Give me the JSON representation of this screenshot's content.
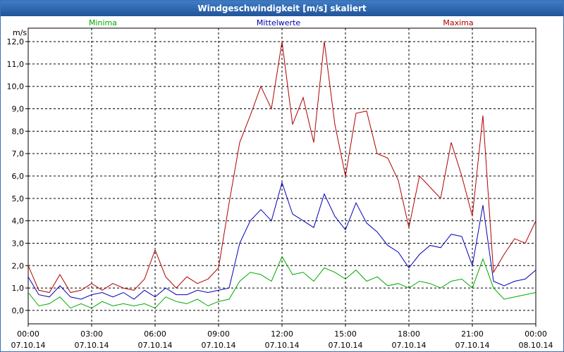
{
  "window": {
    "title": "Windgeschwindigkeit [m/s] skaliert"
  },
  "chart_data": {
    "type": "line",
    "title": "Windgeschwindigkeit [m/s] skaliert",
    "ylabel": "m/s",
    "ylim": [
      -0.6,
      12.6
    ],
    "xlim": [
      0,
      24
    ],
    "grid": true,
    "y_ticks": [
      "0,0",
      "1,0",
      "2,0",
      "3,0",
      "4,0",
      "5,0",
      "6,0",
      "7,0",
      "8,0",
      "9,0",
      "10,0",
      "11,0",
      "12,0"
    ],
    "x_ticks": [
      {
        "time": "00:00",
        "date": "07.10.14"
      },
      {
        "time": "03:00",
        "date": "07.10.14"
      },
      {
        "time": "06:00",
        "date": "07.10.14"
      },
      {
        "time": "09:00",
        "date": "07.10.14"
      },
      {
        "time": "12:00",
        "date": "07.10.14"
      },
      {
        "time": "15:00",
        "date": "07.10.14"
      },
      {
        "time": "18:00",
        "date": "07.10.14"
      },
      {
        "time": "21:00",
        "date": "07.10.14"
      },
      {
        "time": "00:00",
        "date": "08.10.14"
      }
    ],
    "legend": [
      "Minima",
      "Mittelwerte",
      "Maxima"
    ],
    "series": [
      {
        "name": "Minima",
        "color": "#00aa00",
        "x": [
          0,
          0.5,
          1,
          1.5,
          2,
          2.5,
          3,
          3.5,
          4,
          4.5,
          5,
          5.5,
          6,
          6.5,
          7,
          7.5,
          8,
          8.5,
          9,
          9.5,
          10,
          10.5,
          11,
          11.5,
          12,
          12.5,
          13,
          13.5,
          14,
          14.5,
          15,
          15.5,
          16,
          16.5,
          17,
          17.5,
          18,
          18.5,
          19,
          19.5,
          20,
          20.5,
          21,
          21.5,
          22,
          22.5,
          23,
          23.5,
          24
        ],
        "values": [
          0.8,
          0.2,
          0.3,
          0.6,
          0.1,
          0.3,
          0.1,
          0.4,
          0.2,
          0.3,
          0.2,
          0.3,
          0.1,
          0.6,
          0.4,
          0.3,
          0.5,
          0.2,
          0.4,
          0.5,
          1.3,
          1.7,
          1.6,
          1.3,
          2.4,
          1.6,
          1.7,
          1.3,
          1.9,
          1.7,
          1.4,
          1.8,
          1.3,
          1.5,
          1.1,
          1.2,
          1.0,
          1.3,
          1.2,
          1.0,
          1.3,
          1.4,
          1.0,
          2.3,
          1.0,
          0.5,
          0.6,
          0.7,
          0.8
        ]
      },
      {
        "name": "Mittelwerte",
        "color": "#0000b4",
        "x": [
          0,
          0.5,
          1,
          1.5,
          2,
          2.5,
          3,
          3.5,
          4,
          4.5,
          5,
          5.5,
          6,
          6.5,
          7,
          7.5,
          8,
          8.5,
          9,
          9.5,
          10,
          10.5,
          11,
          11.5,
          12,
          12.5,
          13,
          13.5,
          14,
          14.5,
          15,
          15.5,
          16,
          16.5,
          17,
          17.5,
          18,
          18.5,
          19,
          19.5,
          20,
          20.5,
          21,
          21.5,
          22,
          22.5,
          23,
          23.5,
          24
        ],
        "values": [
          1.5,
          0.7,
          0.6,
          1.1,
          0.6,
          0.5,
          0.7,
          0.8,
          0.6,
          0.8,
          0.5,
          0.9,
          0.6,
          1.0,
          0.7,
          0.7,
          0.9,
          0.8,
          0.9,
          1.0,
          3.0,
          4.0,
          4.5,
          4.0,
          5.7,
          4.3,
          4.0,
          3.7,
          5.2,
          4.2,
          3.6,
          4.8,
          3.9,
          3.5,
          2.9,
          2.6,
          1.9,
          2.5,
          2.9,
          2.8,
          3.4,
          3.3,
          2.0,
          4.7,
          1.3,
          1.1,
          1.3,
          1.4,
          1.8
        ]
      },
      {
        "name": "Maxima",
        "color": "#b00000",
        "x": [
          0,
          0.5,
          1,
          1.5,
          2,
          2.5,
          3,
          3.5,
          4,
          4.5,
          5,
          5.5,
          6,
          6.5,
          7,
          7.5,
          8,
          8.5,
          9,
          9.5,
          10,
          10.5,
          11,
          11.5,
          12,
          12.5,
          13,
          13.5,
          14,
          14.5,
          15,
          15.5,
          16,
          16.5,
          17,
          17.5,
          18,
          18.5,
          19,
          19.5,
          20,
          20.5,
          21,
          21.5,
          22,
          22.5,
          23,
          23.5,
          24
        ],
        "values": [
          2.0,
          0.9,
          0.8,
          1.6,
          0.8,
          0.9,
          1.2,
          0.9,
          1.2,
          1.0,
          0.9,
          1.4,
          2.7,
          1.5,
          1.0,
          1.5,
          1.2,
          1.4,
          1.9,
          4.8,
          7.5,
          8.7,
          10.0,
          9.0,
          12.0,
          8.3,
          9.5,
          7.5,
          12.0,
          8.3,
          6.0,
          8.8,
          8.9,
          7.0,
          6.8,
          5.8,
          3.7,
          6.0,
          5.5,
          5.0,
          7.5,
          6.0,
          4.2,
          8.7,
          1.7,
          2.5,
          3.2,
          3.0,
          4.0
        ]
      }
    ]
  }
}
